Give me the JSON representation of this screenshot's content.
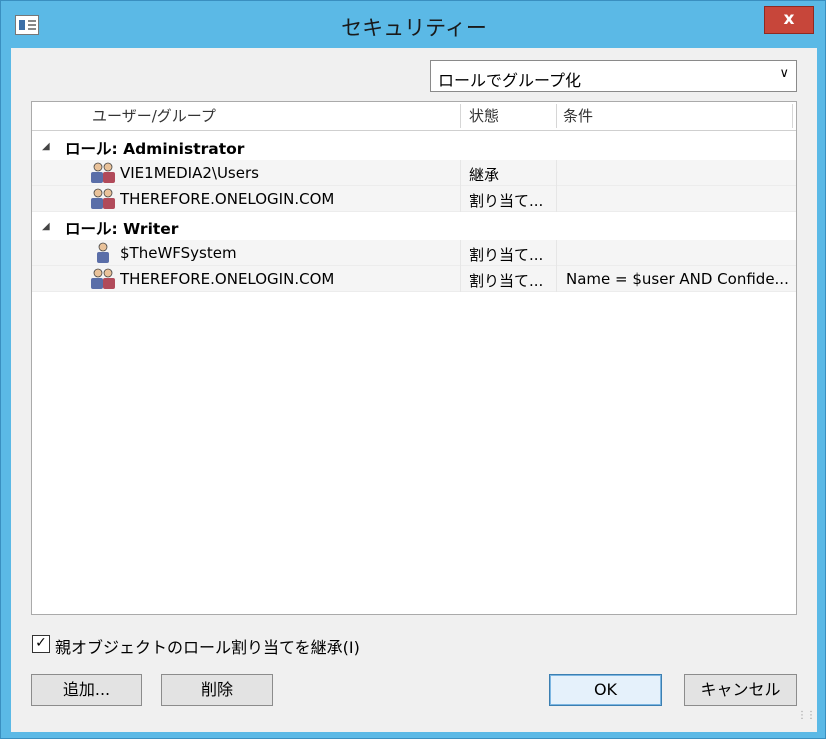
{
  "window": {
    "title": "セキュリティー",
    "close_label": "x"
  },
  "group_by": {
    "selected": "ロールでグループ化"
  },
  "columns": [
    "ユーザー/グループ",
    "状態",
    "条件"
  ],
  "groups": [
    {
      "label": "ロール: Administrator",
      "items": [
        {
          "name": "VIE1MEDIA2\\Users",
          "state": "継承",
          "condition": "",
          "icon": "user-group-icon"
        },
        {
          "name": "THEREFORE.ONELOGIN.COM",
          "state": "割り当て...",
          "condition": "",
          "icon": "user-group-icon"
        }
      ]
    },
    {
      "label": "ロール: Writer",
      "items": [
        {
          "name": "$TheWFSystem",
          "state": "割り当て...",
          "condition": "",
          "icon": "user-icon"
        },
        {
          "name": "THEREFORE.ONELOGIN.COM",
          "state": "割り当て...",
          "condition": "Name = $user AND Confide...",
          "icon": "user-group-icon"
        }
      ]
    }
  ],
  "inherit": {
    "label": "親オブジェクトのロール割り当てを継承(I)",
    "checked": true
  },
  "buttons": {
    "add": "追加...",
    "delete": "削除",
    "ok": "OK",
    "cancel": "キャンセル"
  },
  "colors": {
    "titlebar": "#5bb9e6",
    "close": "#c7463a",
    "default_button_border": "#3c7fb1"
  }
}
